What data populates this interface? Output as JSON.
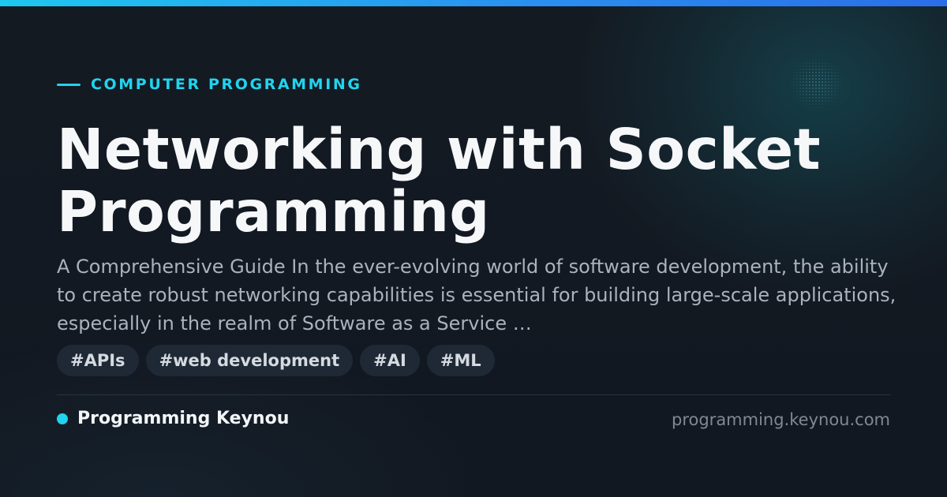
{
  "category": "COMPUTER PROGRAMMING",
  "title": "Networking with Socket Programming",
  "excerpt": "A Comprehensive Guide In the ever-evolving world of software development, the ability to create robust networking capabilities is essential for building large-scale applications, especially in the realm of Software as a Service …",
  "tags": [
    "#APIs",
    "#web development",
    "#AI",
    "#ML"
  ],
  "brand": {
    "name": "Programming Keynou"
  },
  "domain": "programming.keynou.com",
  "colors": {
    "accent": "#22d3ee",
    "background": "#121821",
    "tag_background": "#1f2936",
    "title": "#f6f7f9"
  }
}
